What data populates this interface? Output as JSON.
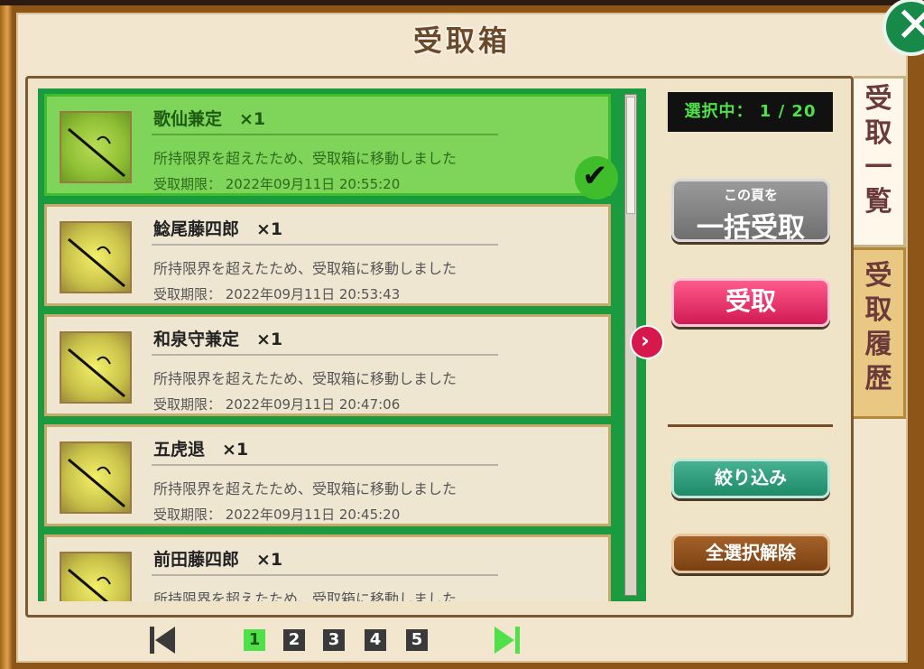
{
  "title": "受取箱",
  "counter": "選択中： 1 / 20",
  "items": [
    {
      "name": "歌仙兼定　×1",
      "desc": "所持限界を超えたため、受取箱に移動しました",
      "limit": "受取期限： 2022年09月11日 20:55:20",
      "selected": true
    },
    {
      "name": "鯰尾藤四郎　×1",
      "desc": "所持限界を超えたため、受取箱に移動しました",
      "limit": "受取期限： 2022年09月11日 20:53:43",
      "selected": false
    },
    {
      "name": "和泉守兼定　×1",
      "desc": "所持限界を超えたため、受取箱に移動しました",
      "limit": "受取期限： 2022年09月11日 20:47:06",
      "selected": false
    },
    {
      "name": "五虎退　×1",
      "desc": "所持限界を超えたため、受取箱に移動しました",
      "limit": "受取期限： 2022年09月11日 20:45:20",
      "selected": false
    },
    {
      "name": "前田藤四郎　×1",
      "desc": "所持限界を超えたため、受取箱に移動しました",
      "limit": "",
      "selected": false
    }
  ],
  "buttons": {
    "bulk_sub": "この頁を",
    "bulk_main": "一括受取",
    "receive": "受取",
    "filter": "絞り込み",
    "clear_all": "全選択解除"
  },
  "tabs": {
    "list": [
      "受",
      "取",
      "一",
      "覧"
    ],
    "history": [
      "受",
      "取",
      "履",
      "歴"
    ]
  },
  "pager": {
    "pages": [
      "1",
      "2",
      "3",
      "4",
      "5"
    ],
    "current": "1"
  },
  "colors": {
    "list_border": "#1b9b3f",
    "selected_bg": "#7fd45a",
    "receive_btn": "#d11a55",
    "filter_btn": "#1f8a68",
    "clear_btn": "#7a4012",
    "counter_text": "#4fe04a"
  },
  "icons": {
    "close": "close-icon",
    "check": "checkmark-icon",
    "next": "chevron-right-icon",
    "first": "first-page-icon",
    "last": "last-page-icon",
    "item_thumb": "sword-icon"
  }
}
